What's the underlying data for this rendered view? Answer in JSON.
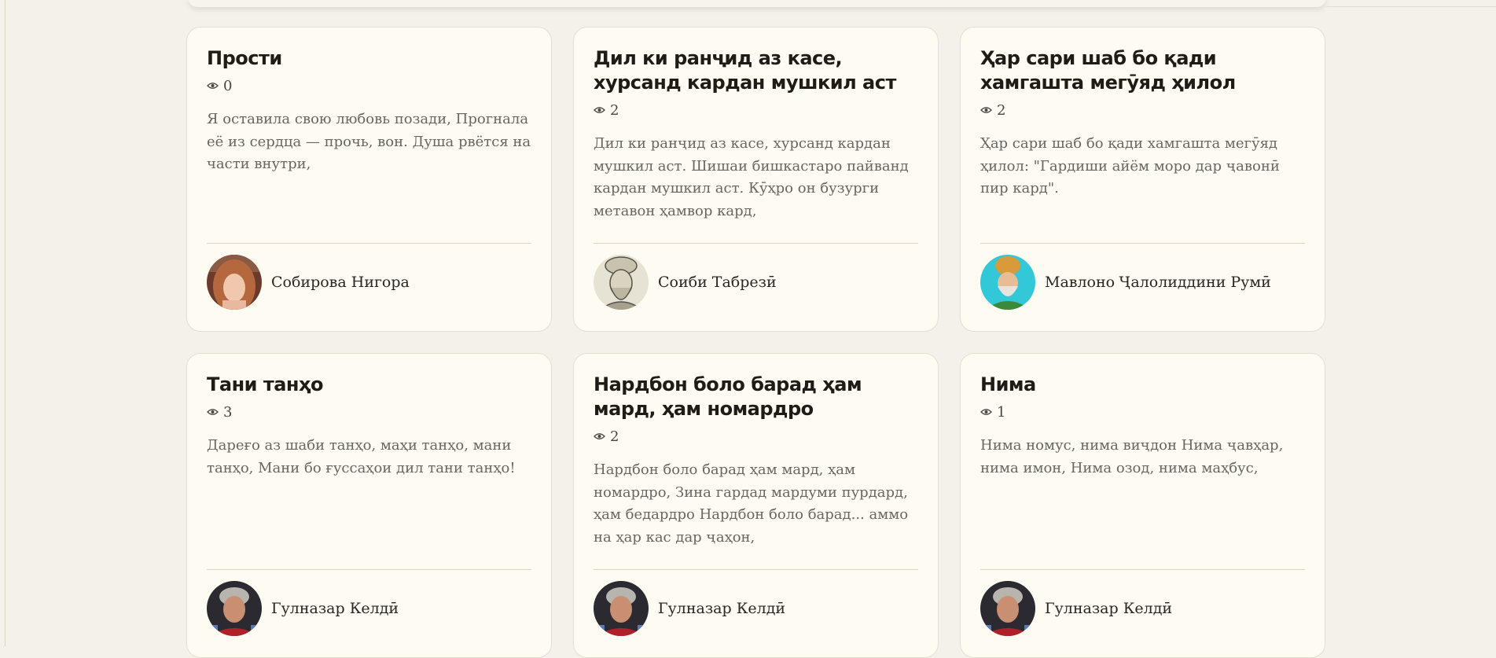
{
  "cards": [
    {
      "title": "Прости",
      "views": "0",
      "excerpt": "Я оставила свою любовь позади, Прогнала её из сердца — прочь, вон. Душа рвётся на части внутри,",
      "author": "Собирова Нигора"
    },
    {
      "title": "Дил ки ранҷид аз касе, хурсанд кардан мушкил аст",
      "views": "2",
      "excerpt": "Дил ки ранҷид аз касе, хурсанд кардан мушкил аст. Шишаи бишкастаро пайванд кардан мушкил аст. Кӯҳро он бузурги метавон ҳамвор кард,",
      "author": "Соиби Табрезӣ"
    },
    {
      "title": "Ҳар сари шаб бо қади хамгашта мегӯяд ҳилол",
      "views": "2",
      "excerpt": "Ҳар сари шаб бо қади хамгашта мегӯяд ҳилол: \"Гардиши айём моро дар ҷавонӣ пир кард\".",
      "author": "Мавлоно Ҷалолиддини Румӣ"
    },
    {
      "title": "Тани танҳо",
      "views": "3",
      "excerpt": "Дареғо аз шаби танҳо, маҳи танҳо, мани танҳо, Мани бо ғуссаҳои дил тани танҳо!",
      "author": "Гулназар Келдӣ"
    },
    {
      "title": "Нардбон боло барад ҳам мард, ҳам номардро",
      "views": "2",
      "excerpt": "Нардбон боло барад ҳам мард, ҳам номардро, Зина гардад мардуми пурдард, ҳам бедардро Нардбон боло барад... аммо на ҳар кас дар ҷаҳон,",
      "author": "Гулназар Келдӣ"
    },
    {
      "title": "Нима",
      "views": "1",
      "excerpt": "Нима номус, нима виҷдон Нима ҷавҳар, нима имон, Нима озод, нима маҳбус,",
      "author": "Гулназар Келдӣ"
    }
  ]
}
